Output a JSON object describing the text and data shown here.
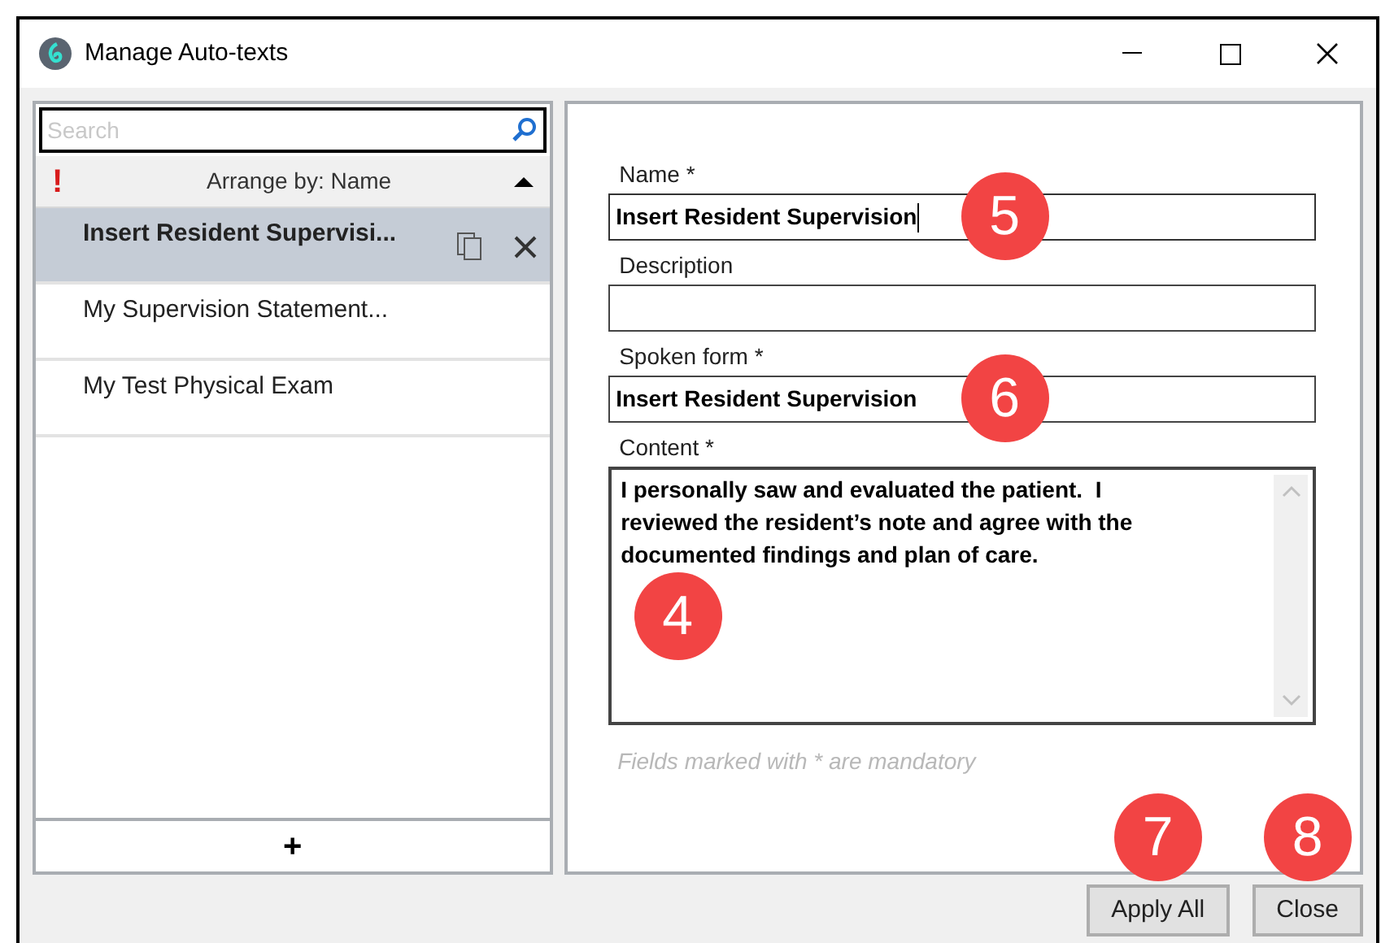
{
  "window": {
    "title": "Manage Auto-texts"
  },
  "search": {
    "placeholder": "Search"
  },
  "arrange": {
    "alert": "!",
    "label": "Arrange by: Name"
  },
  "items": [
    {
      "name": "Insert Resident Supervisi...",
      "selected": true
    },
    {
      "name": "My Supervision Statement...",
      "selected": false
    },
    {
      "name": "My Test Physical Exam",
      "selected": false
    }
  ],
  "add_button": "+",
  "fields": [
    {
      "kind": "input",
      "label": "Name *",
      "value": "Insert Resident Supervision",
      "focused": true,
      "callout": "5"
    },
    {
      "kind": "input",
      "label": "Description",
      "focused": false
    },
    {
      "kind": "input",
      "label": "Spoken form *",
      "value": "Insert Resident Supervision",
      "focused": false,
      "callout": "6"
    },
    {
      "kind": "textarea",
      "label": "Content *",
      "value": "I personally saw and evaluated the patient.  I reviewed the resident’s note and agree with the documented findings and plan of care.",
      "focused": false,
      "callout": "4"
    }
  ],
  "hint": "Fields marked with * are mandatory",
  "buttons": [
    {
      "label": "Apply All",
      "callout": "7"
    },
    {
      "label": "Close",
      "callout": "8"
    }
  ]
}
